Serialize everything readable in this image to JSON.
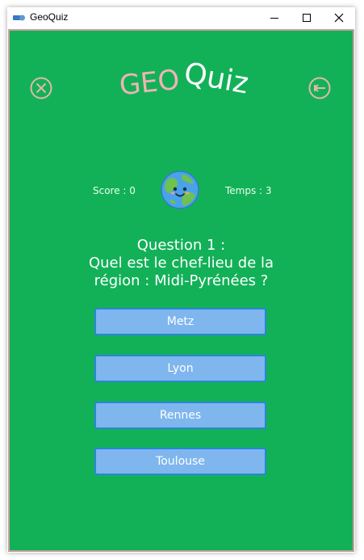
{
  "window": {
    "title": "GeoQuiz",
    "controls": [
      "minimize",
      "maximize",
      "close"
    ]
  },
  "logo": {
    "part1": "GEO",
    "part2": "Quiz",
    "color1": "#f0b3b3",
    "color2": "#ffffff"
  },
  "toolbar": {
    "close_icon": "circle-x-icon",
    "back_icon": "circle-back-arrow-icon",
    "icon_color": "#e3b8a7"
  },
  "status": {
    "score_label": "Score : 0",
    "time_label": "Temps : 3",
    "mascot_icon": "smiling-globe-icon"
  },
  "question": {
    "line1": "Question 1 :",
    "line2": "Quel est le chef-lieu de la",
    "line3": "région : Midi-Pyrénées ?"
  },
  "answers": [
    {
      "label": "Metz"
    },
    {
      "label": "Lyon"
    },
    {
      "label": "Rennes"
    },
    {
      "label": "Toulouse"
    }
  ],
  "colors": {
    "background": "#12b158",
    "answer_fill": "#7fb6ee",
    "answer_border": "#2a85d9",
    "frame": "#c9a1a1"
  }
}
